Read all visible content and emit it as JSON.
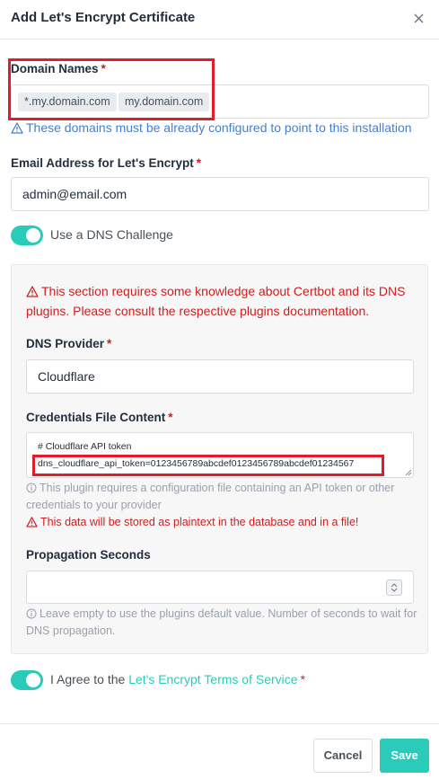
{
  "modal": {
    "title": "Add Let's Encrypt Certificate",
    "close_icon": "close-icon"
  },
  "domain_names": {
    "label": "Domain Names",
    "required_mark": "*",
    "tags": [
      "*.my.domain.com",
      "my.domain.com"
    ],
    "hint": "These domains must be already configured to point to this installation",
    "hint_icon": "warning-triangle-icon"
  },
  "email": {
    "label": "Email Address for Let's Encrypt",
    "required_mark": "*",
    "value": "admin@email.com"
  },
  "dns_challenge": {
    "label": "Use a DNS Challenge",
    "enabled": true
  },
  "dns_section": {
    "warning": "This section requires some knowledge about Certbot and its DNS plugins. Please consult the respective plugins documentation.",
    "warning_icon": "warning-triangle-icon",
    "provider": {
      "label": "DNS Provider",
      "required_mark": "*",
      "value": "Cloudflare"
    },
    "credentials": {
      "label": "Credentials File Content",
      "required_mark": "*",
      "line1": "# Cloudflare API token",
      "line2": "dns_cloudflare_api_token=0123456789abcdef0123456789abcdef01234567",
      "hint": "This plugin requires a configuration file containing an API token or other credentials to your provider",
      "hint_icon": "info-circle-icon",
      "warning": "This data will be stored as plaintext in the database and in a file!",
      "warning_icon": "warning-triangle-icon"
    },
    "propagation": {
      "label": "Propagation Seconds",
      "value": "",
      "hint": "Leave empty to use the plugins default value. Number of seconds to wait for DNS propagation.",
      "hint_icon": "info-circle-icon"
    }
  },
  "agree": {
    "prefix": "I Agree to the",
    "link_text": "Let's Encrypt Terms of Service",
    "required_mark": "*",
    "enabled": true
  },
  "footer": {
    "cancel_label": "Cancel",
    "save_label": "Save"
  },
  "colors": {
    "accent": "#2bcbba",
    "danger": "#cd201f",
    "info": "#467fcf",
    "highlight": "#e11d2a"
  }
}
